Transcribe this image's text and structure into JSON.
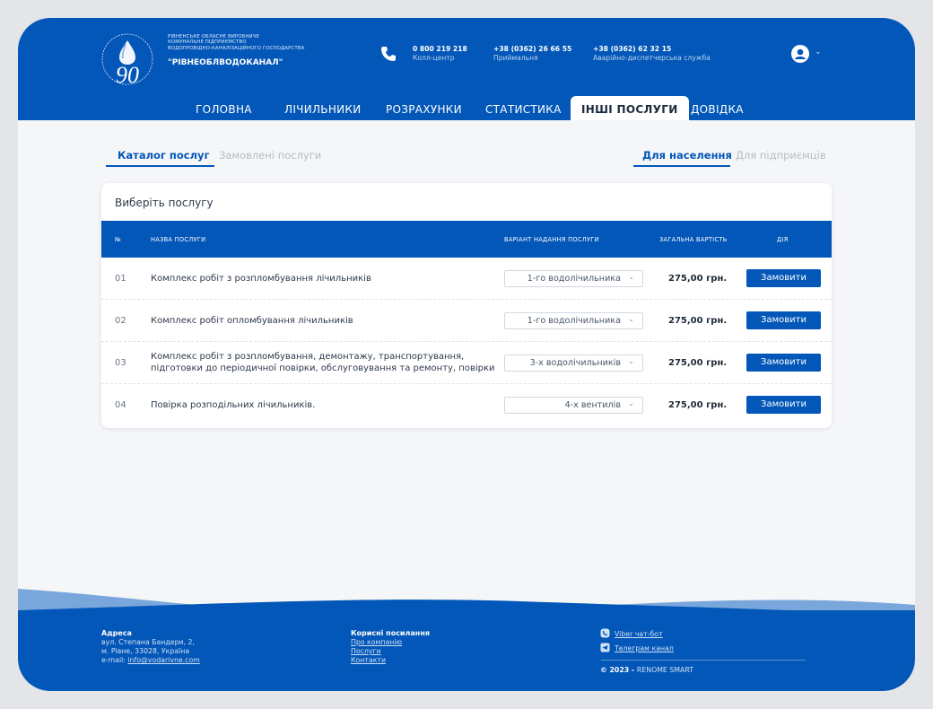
{
  "header": {
    "org_small_lines": [
      "РІВНЕНСЬКЕ ОБЛАСНЕ ВИРОБНИЧЕ",
      "КОМУНАЛЬНЕ ПІДПРИЄМСТВО",
      "ВОДОПРОВІДНО-КАНАЛІЗАЦІЙНОГО ГОСПОДАРСТВА"
    ],
    "org_name": "\"РІВНЕОБЛВОДОКАНАЛ\"",
    "logo_ring_text": "РІВНЕОБЛВОДОКАНАЛ",
    "logo_number": "90",
    "contacts": [
      {
        "number": "0 800 219 218",
        "label": "Колл-центр"
      },
      {
        "number": "+38 (0362) 26 66 55",
        "label": "Приймальня"
      },
      {
        "number": "+38 (0362) 62 32 15",
        "label": "Аварійно-диспетчерська служба"
      }
    ],
    "user_menu_icon": "user-avatar-icon"
  },
  "nav": {
    "items": [
      "ГОЛОВНА",
      "ЛІЧИЛЬНИКИ",
      "РОЗРАХУНКИ",
      "СТАТИСТИКА",
      "ІНШІ ПОСЛУГИ",
      "ДОВІДКА"
    ],
    "active": "ІНШІ ПОСЛУГИ"
  },
  "tabs": {
    "left": [
      {
        "label": "Каталог послуг",
        "active": true
      },
      {
        "label": "Замовлені послуги",
        "active": false
      }
    ],
    "right": [
      {
        "label": "Для населення",
        "active": true
      },
      {
        "label": "Для підприємців",
        "active": false
      }
    ]
  },
  "services": {
    "title": "Виберіть послугу",
    "columns": [
      "№",
      "НАЗВА ПОСЛУГИ",
      "ВАРІАНТ НАДАННЯ ПОСЛУГИ",
      "ЗАГАЛЬНА ВАРТІСТЬ",
      "ДІЯ"
    ],
    "rows": [
      {
        "num": "01",
        "name": "Комплекс робіт з розпломбування лічильників",
        "variant": "1-го водолічильника",
        "price": "275,00 грн.",
        "action": "Замовити"
      },
      {
        "num": "02",
        "name": "Комплекс робіт опломбування лічильників",
        "variant": "1-го водолічильника",
        "price": "275,00 грн.",
        "action": "Замовити"
      },
      {
        "num": "03",
        "name": "Комплекс робіт з розпломбування, демонтажу, транспортування, підготовки до періодичної повірки, обслуговування та ремонту, повірки",
        "variant": "3-х водолічильників",
        "price": "275,00 грн.",
        "action": "Замовити"
      },
      {
        "num": "04",
        "name": "Повірка розподільних лічильників.",
        "variant": "4-х вентилів",
        "price": "275,00 грн.",
        "action": "Замовити"
      }
    ]
  },
  "footer": {
    "address_title": "Адреса",
    "address_lines": [
      "вул. Степана Бандери, 2,",
      "м. Рівне, 33028, Україна"
    ],
    "email_prefix": "e-mail: ",
    "email": "info@vodarivne.com",
    "links_title": "Корисні посилання",
    "links": [
      "Про компанію",
      "Послуги",
      "Контакти"
    ],
    "viber": "Viber чат-бот",
    "telegram": "Телеграм канал",
    "copyright_year": "© 2023 - ",
    "copyright_name": "RENOME SMART"
  },
  "colors": {
    "brand": "#0357b8",
    "background": "#f5f6f8",
    "text": "#2e3a4a"
  }
}
